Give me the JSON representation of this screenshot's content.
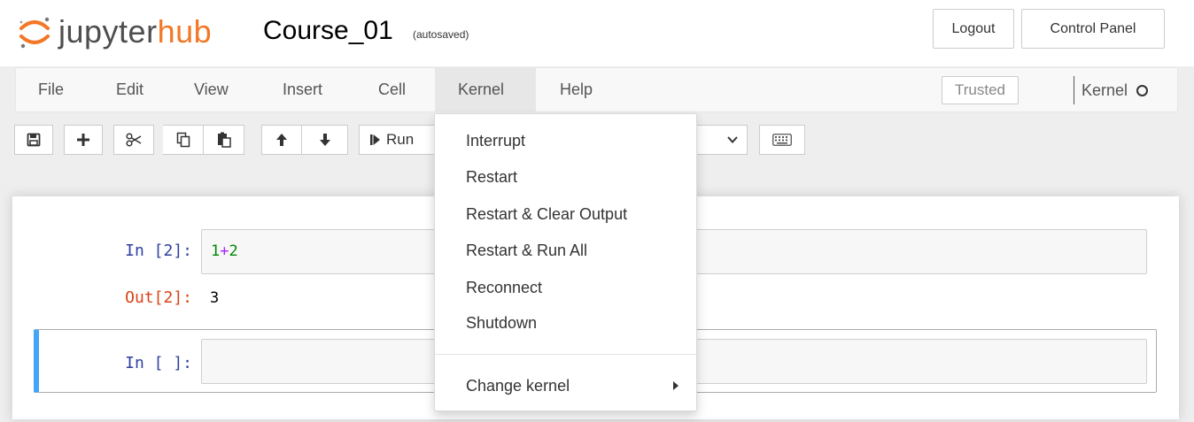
{
  "header": {
    "logo_jupyter": "jupyter",
    "logo_hub": "hub",
    "notebook_name": "Course_01",
    "autosave_status": "(autosaved)",
    "logout_label": "Logout",
    "control_panel_label": "Control Panel"
  },
  "menubar": {
    "items": [
      "File",
      "Edit",
      "View",
      "Insert",
      "Cell",
      "Kernel",
      "Help"
    ],
    "active": "Kernel",
    "trusted_label": "Trusted",
    "kernel_label": "Kernel"
  },
  "toolbar": {
    "run_label": "Run",
    "icons": [
      "save-icon",
      "plus-icon",
      "cut-icon",
      "copy-icon",
      "paste-icon",
      "arrow-up-icon",
      "arrow-down-icon",
      "step-forward-icon",
      "chevron-down-icon",
      "keyboard-icon"
    ]
  },
  "kernel_menu": {
    "items": [
      "Interrupt",
      "Restart",
      "Restart & Clear Output",
      "Restart & Run All",
      "Reconnect",
      "Shutdown"
    ],
    "submenu_label": "Change kernel"
  },
  "cells": [
    {
      "in_prompt": "In [2]:",
      "code": {
        "a": "1",
        "op": "+",
        "b": "2"
      },
      "out_prompt": "Out[2]:",
      "output": "3"
    },
    {
      "in_prompt": "In [ ]:",
      "code_text": ""
    }
  ],
  "colors": {
    "hub_orange": "#f37726",
    "in_prompt": "#303f9f",
    "out_prompt": "#d84315",
    "selected_cell_border": "#42a5f5"
  }
}
